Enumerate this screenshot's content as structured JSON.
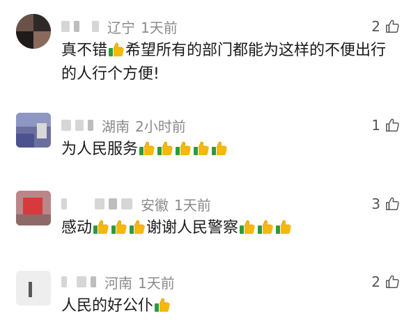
{
  "colors": {
    "meta_text": "#8a8a8a",
    "body_text": "#1a1a1a",
    "emoji_yellow": "#f5b80b",
    "emoji_green": "#2e9a3e"
  },
  "comments": [
    {
      "region": "辽宁",
      "time": "1天前",
      "likes": "2",
      "text_parts": [
        "真不错",
        "希望所有的部门都能为这样的不便出行",
        "的人行个方便!"
      ]
    },
    {
      "region": "湖南",
      "time": "2小时前",
      "likes": "1",
      "text_parts": [
        "为人民服务"
      ]
    },
    {
      "region": "安徽",
      "time": "1天前",
      "likes": "3",
      "text_parts": [
        "感动",
        "谢谢人民警察"
      ]
    },
    {
      "region": "河南",
      "time": "1天前",
      "likes": "2",
      "text_parts": [
        "人民的好公仆"
      ]
    }
  ],
  "icons": {
    "like": "thumbs-up-outline-icon",
    "emoji": "thumbs-up-emoji-icon"
  }
}
